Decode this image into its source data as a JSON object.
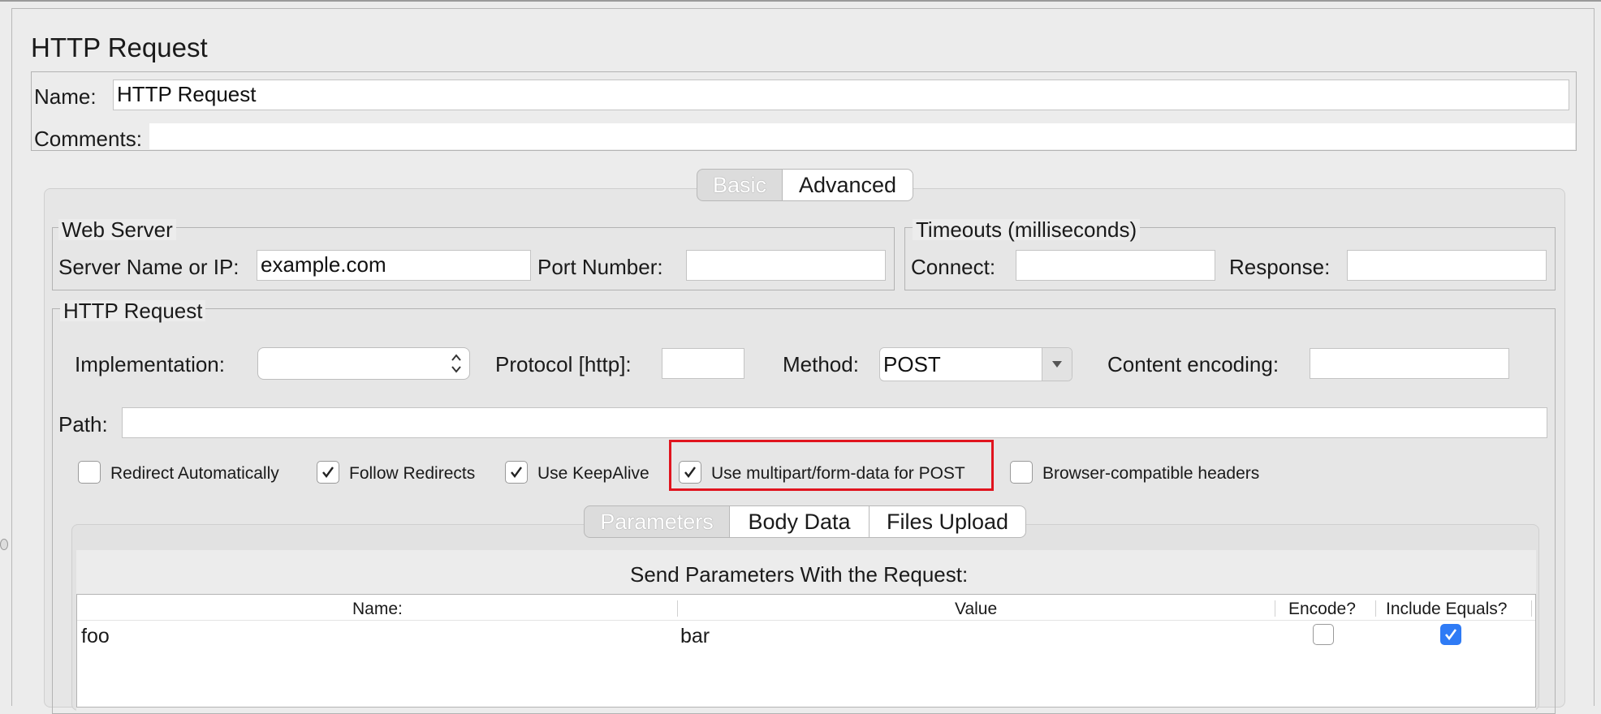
{
  "panel": {
    "title": "HTTP Request",
    "name_label": "Name:",
    "name_value": "HTTP Request",
    "comments_label": "Comments:",
    "comments_value": ""
  },
  "main_tabs": [
    {
      "label": "Basic",
      "selected": true
    },
    {
      "label": "Advanced",
      "selected": false
    }
  ],
  "web_server": {
    "title": "Web Server",
    "server_label": "Server Name or IP:",
    "server_value": "example.com",
    "port_label": "Port Number:",
    "port_value": ""
  },
  "timeouts": {
    "title": "Timeouts (milliseconds)",
    "connect_label": "Connect:",
    "connect_value": "",
    "response_label": "Response:",
    "response_value": ""
  },
  "http_request": {
    "title": "HTTP Request",
    "implementation_label": "Implementation:",
    "implementation_value": "",
    "protocol_label": "Protocol [http]:",
    "protocol_value": "",
    "method_label": "Method:",
    "method_value": "POST",
    "encoding_label": "Content encoding:",
    "encoding_value": "",
    "path_label": "Path:",
    "path_value": ""
  },
  "options": [
    {
      "label": "Redirect Automatically",
      "checked": false
    },
    {
      "label": "Follow Redirects",
      "checked": true
    },
    {
      "label": "Use KeepAlive",
      "checked": true
    },
    {
      "label": "Use multipart/form-data for POST",
      "checked": true,
      "highlighted": true
    },
    {
      "label": "Browser-compatible headers",
      "checked": false
    }
  ],
  "sub_tabs": [
    {
      "label": "Parameters",
      "selected": true
    },
    {
      "label": "Body Data",
      "selected": false
    },
    {
      "label": "Files Upload",
      "selected": false
    }
  ],
  "params": {
    "heading": "Send Parameters With the Request:",
    "columns": [
      "Name:",
      "Value",
      "Encode?",
      "Include Equals?"
    ],
    "rows": [
      {
        "name": "foo",
        "value": "bar",
        "encode": false,
        "include_equals": true
      }
    ]
  },
  "colors": {
    "highlight": "#e0141e",
    "checkbox_blue": "#2f7bf5"
  }
}
